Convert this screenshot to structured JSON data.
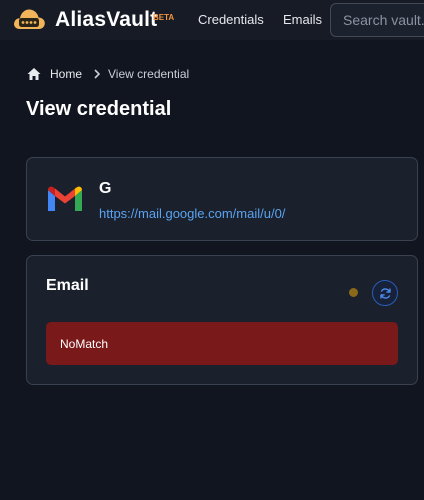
{
  "app": {
    "brand": "AliasVault",
    "badge": "BETA",
    "brand_color": "#f49541"
  },
  "nav": {
    "items": [
      {
        "label": "Credentials"
      },
      {
        "label": "Emails"
      }
    ],
    "search_placeholder": "Search vault..."
  },
  "breadcrumb": {
    "home_label": "Home",
    "current_label": "View credential"
  },
  "page": {
    "title": "View credential"
  },
  "credential": {
    "service_name": "G",
    "service_url": "https://mail.google.com/mail/u/0/",
    "service_icon": "gmail-icon"
  },
  "email_section": {
    "title": "Email",
    "status_color": "#8a6a1a",
    "alert_text": "NoMatch",
    "alert_color": "#7a1919"
  }
}
